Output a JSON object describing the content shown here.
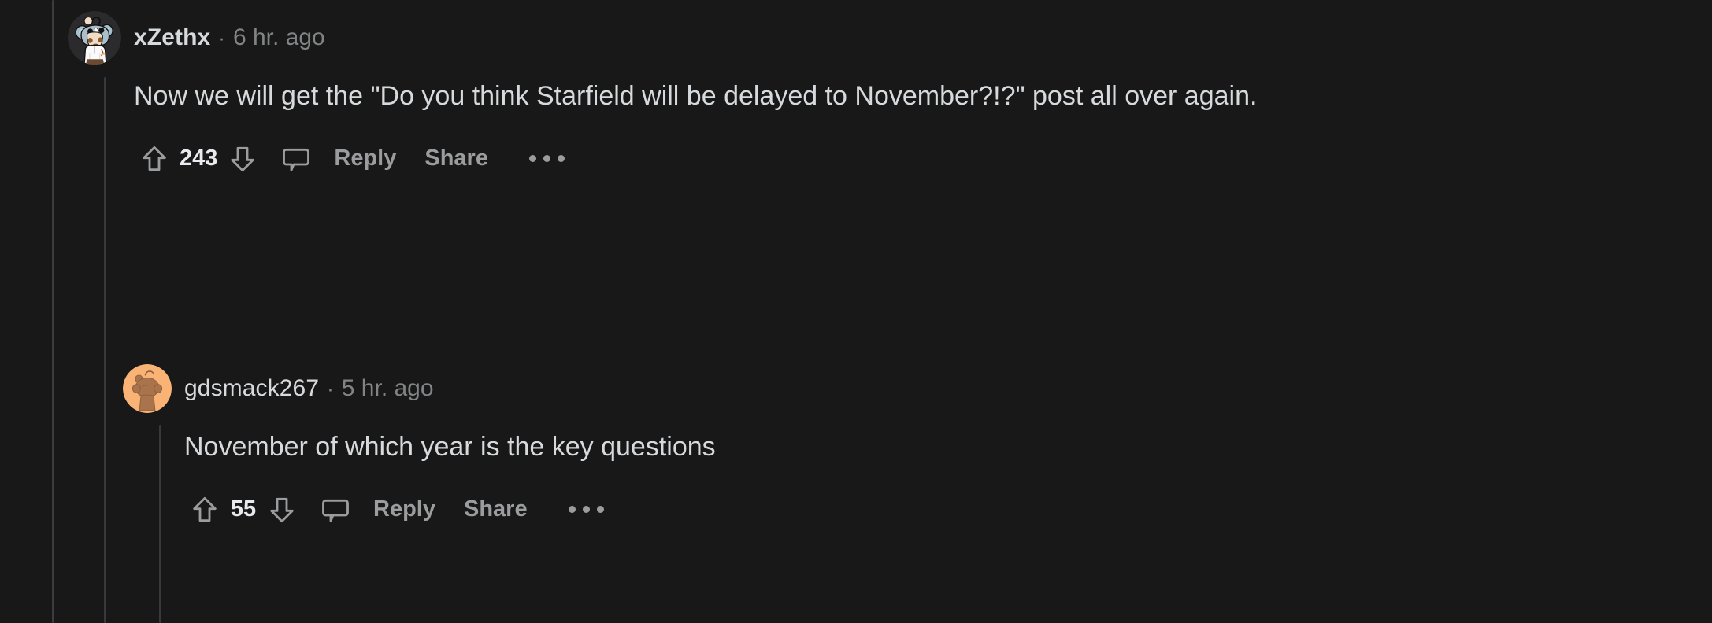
{
  "theme": {
    "background": "#181818",
    "text_primary": "#d7dadc",
    "text_muted": "#818384",
    "action_text": "#9a9c9e",
    "thread_line": "#373a3c",
    "snoo_orange": "#f9b475"
  },
  "comments": [
    {
      "username": "xZethx",
      "separator": "·",
      "timestamp": "6 hr. ago",
      "body": "Now we will get the \"Do you think Starfield will be delayed to November?!?\" post all over again.",
      "vote_count": "243",
      "upvote_icon": "arrow-up-icon",
      "downvote_icon": "arrow-down-icon",
      "comment_icon": "comment-bubble-icon",
      "reply_label": "Reply",
      "share_label": "Share",
      "more_icon": "more-horizontal-icon",
      "avatar_icon": "avatar-koala-hoodie"
    },
    {
      "username": "gdsmack267",
      "separator": "·",
      "timestamp": "5 hr. ago",
      "body": "November of which year is the key questions",
      "vote_count": "55",
      "upvote_icon": "arrow-up-icon",
      "downvote_icon": "arrow-down-icon",
      "comment_icon": "comment-bubble-icon",
      "reply_label": "Reply",
      "share_label": "Share",
      "more_icon": "more-horizontal-icon",
      "avatar_icon": "avatar-snoo-orange"
    }
  ]
}
